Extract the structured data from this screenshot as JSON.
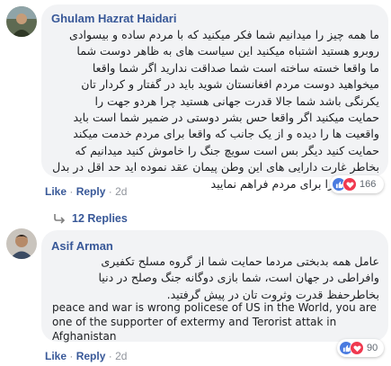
{
  "comments": [
    {
      "author": "Ghulam Hazrat Haidari",
      "lines": [
        "ما همه چیز را میدانیم شما فکر میکنید که با مردم ساده و بیسوادی",
        "روبرو هستید اشتباه میکنید این سیاست های به ظاهر دوست شما",
        "ما واقعا خسته ساخته است شما صداقت ندارید اگر شما واقعا",
        "میخواهید دوست مردم افغانستان شوید باید در گفتار و کردار تان",
        "یکرنگی باشد شما جالا قدرت جهانی هستید چرا هردو جهت را",
        "حمایت میکنید اگر واقعا حس بشر دوستی در ضمیر شما است باید",
        "واقعیت ها را دیده و از یک جانب که واقعا برای مردم خدمت میکند",
        "حمایت کنید دیگر بس است سویچ جنگ را خاموش کنید میدانیم که",
        "بخاطر غارت دارایی های این وطن پیمان عقد نموده اید حد اقل در بدل",
        "آن امنیت را برای مردم فراهم نمایید"
      ],
      "like_label": "Like",
      "reply_label": "Reply",
      "time": "2d",
      "reaction_count": "166"
    },
    {
      "author": "Asif Arman",
      "rtl_lines": [
        "عامل همه بدبختی مردما حمایت شما از گروه مسلح تکفیری",
        "وافراطی در جهان است، شما بازی دوگانه جنگ وصلح در دنیا",
        "بخاطرحفظ قدرت وثروت تان در پیش گرفتید."
      ],
      "ltr_lines": [
        "peace and war is wrong policese of US in the World, you are",
        "one of the supporter of extermy and Terorist attak in",
        "Afghanistan"
      ],
      "like_label": "Like",
      "reply_label": "Reply",
      "time": "2d",
      "reaction_count": "90"
    }
  ],
  "replies_link": "12 Replies",
  "colors": {
    "link": "#385898",
    "bubble": "#f2f3f5",
    "like_reaction": "#4a7be0",
    "love_reaction": "#f0394f"
  }
}
